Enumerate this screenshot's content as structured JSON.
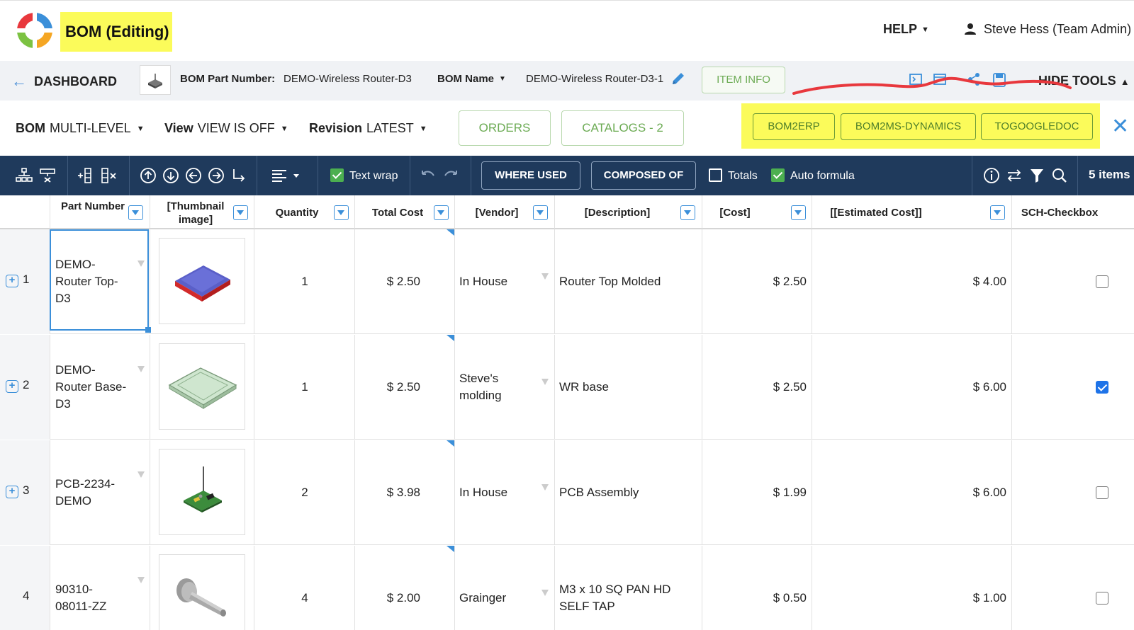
{
  "app": {
    "title": "BOM (Editing)",
    "help_label": "HELP",
    "user_label": "Steve Hess (Team Admin)"
  },
  "infobar": {
    "back_label": "DASHBOARD",
    "part_number_label": "BOM Part Number:",
    "part_number_value": "DEMO-Wireless Router-D3",
    "bom_name_label": "BOM Name",
    "bom_name_value": "DEMO-Wireless Router-D3-1",
    "item_info_label": "ITEM INFO",
    "hide_tools_label": "HIDE TOOLS"
  },
  "filterbar": {
    "bom_label": "BOM",
    "bom_value": "MULTI-LEVEL",
    "view_label": "View",
    "view_value": "VIEW IS OFF",
    "revision_label": "Revision",
    "revision_value": "LATEST",
    "orders_label": "ORDERS",
    "catalogs_label": "CATALOGS - 2",
    "integrations": [
      "BOM2ERP",
      "BOM2MS-DYNAMICS",
      "TOGOOGLEDOC"
    ]
  },
  "toolbar": {
    "text_wrap_label": "Text wrap",
    "where_used_label": "WHERE USED",
    "composed_of_label": "COMPOSED OF",
    "totals_label": "Totals",
    "auto_formula_label": "Auto formula",
    "items_count": "5 items",
    "text_wrap_checked": true,
    "totals_checked": false,
    "auto_formula_checked": true
  },
  "grid": {
    "headers": [
      "Part Number",
      "[Thumbnail image]",
      "Quantity",
      "Total Cost",
      "[Vendor]",
      "[Description]",
      "[Cost]",
      "[[Estimated Cost]]",
      "SCH-Checkbox"
    ],
    "rows": [
      {
        "num": "1",
        "part": "DEMO-Router Top-D3",
        "part_lines": [
          "DEMO-",
          "Router Top-",
          "D3"
        ],
        "thumb": "router-top",
        "qty": "1",
        "total": "$ 2.50",
        "vendor": "In House",
        "vendor_lines": [
          "In House"
        ],
        "desc": "Router Top Molded",
        "desc_lines": [
          "Router Top Molded"
        ],
        "cost": "$ 2.50",
        "est": "$ 4.00",
        "sch": false,
        "expandable": true
      },
      {
        "num": "2",
        "part": "DEMO-Router Base-D3",
        "part_lines": [
          "DEMO-",
          "Router Base-",
          "D3"
        ],
        "thumb": "router-base",
        "qty": "1",
        "total": "$ 2.50",
        "vendor": "Steve's molding",
        "vendor_lines": [
          "Steve's",
          "molding"
        ],
        "desc": "WR base",
        "desc_lines": [
          "WR base"
        ],
        "cost": "$ 2.50",
        "est": "$ 6.00",
        "sch": true,
        "expandable": true
      },
      {
        "num": "3",
        "part": "PCB-2234-DEMO",
        "part_lines": [
          "PCB-2234-",
          "DEMO"
        ],
        "thumb": "pcb",
        "qty": "2",
        "total": "$ 3.98",
        "vendor": "In House",
        "vendor_lines": [
          "In House"
        ],
        "desc": "PCB Assembly",
        "desc_lines": [
          "PCB Assembly"
        ],
        "cost": "$ 1.99",
        "est": "$ 6.00",
        "sch": false,
        "expandable": true
      },
      {
        "num": "4",
        "part": "90310-08011-ZZ",
        "part_lines": [
          "90310-",
          "08011-ZZ"
        ],
        "thumb": "screw",
        "qty": "4",
        "total": "$ 2.00",
        "vendor": "Grainger",
        "vendor_lines": [
          "Grainger"
        ],
        "desc": "M3 x 10 SQ PAN HD SELF TAP",
        "desc_lines": [
          "M3 x 10 SQ PAN HD",
          "SELF TAP"
        ],
        "cost": "$ 0.50",
        "est": "$ 1.00",
        "sch": false,
        "expandable": false
      }
    ]
  },
  "colors": {
    "highlight": "#fbfb5a",
    "toolbar_bg": "#1f3a5c",
    "accent_blue": "#3b8fd9",
    "green": "#6cab54",
    "annotation_red": "#e8383d"
  }
}
